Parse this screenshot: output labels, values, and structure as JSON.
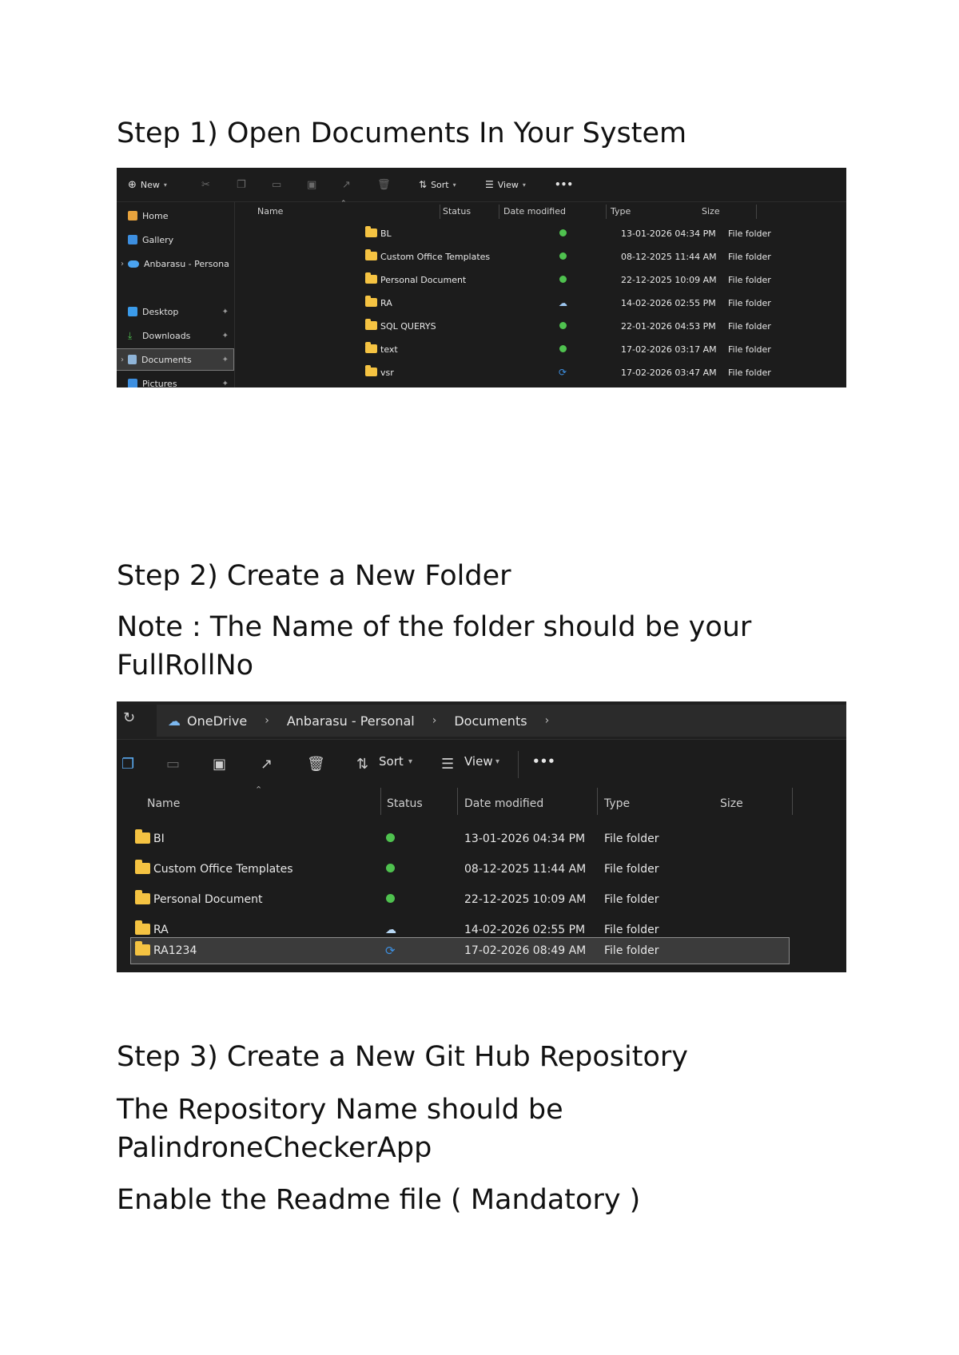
{
  "steps": {
    "step1_title": "Step 1) Open Documents In Your System",
    "step2_title": "Step 2) Create a New Folder",
    "step2_note": "Note : The Name of the folder should be your FullRollNo",
    "step3_title": "Step 3) Create a New Git Hub Repository",
    "step3_line1": "The Repository Name should be PalindroneCheckerApp",
    "step3_line2": "Enable the Readme file ( Mandatory )"
  },
  "shot1": {
    "toolbar": {
      "new": "New",
      "sort": "Sort",
      "view": "View",
      "more": "•••"
    },
    "sidebar": [
      {
        "label": "Home",
        "icon": "home-icon",
        "pinned": false
      },
      {
        "label": "Gallery",
        "icon": "gallery-icon",
        "pinned": false
      },
      {
        "label": "Anbarasu - Persona",
        "icon": "onedrive-icon",
        "pinned": false
      },
      {
        "label": "Desktop",
        "icon": "desktop-icon",
        "pinned": true
      },
      {
        "label": "Downloads",
        "icon": "download-icon",
        "pinned": true
      },
      {
        "label": "Documents",
        "icon": "documents-icon",
        "pinned": true
      },
      {
        "label": "Pictures",
        "icon": "pictures-icon",
        "pinned": true
      }
    ],
    "columns": {
      "name": "Name",
      "status": "Status",
      "date": "Date modified",
      "type": "Type",
      "size": "Size"
    },
    "rows": [
      {
        "name": "BL",
        "status": "synced",
        "date": "13-01-2026 04:34 PM",
        "type": "File folder"
      },
      {
        "name": "Custom Office Templates",
        "status": "synced",
        "date": "08-12-2025 11:44 AM",
        "type": "File folder"
      },
      {
        "name": "Personal Document",
        "status": "synced",
        "date": "22-12-2025 10:09 AM",
        "type": "File folder"
      },
      {
        "name": "RA",
        "status": "cloud",
        "date": "14-02-2026 02:55 PM",
        "type": "File folder"
      },
      {
        "name": "SQL QUERYS",
        "status": "synced",
        "date": "22-01-2026 04:53 PM",
        "type": "File folder"
      },
      {
        "name": "text",
        "status": "synced",
        "date": "17-02-2026 03:17 AM",
        "type": "File folder"
      },
      {
        "name": "vsr",
        "status": "syncing",
        "date": "17-02-2026 03:47 AM",
        "type": "File folder"
      }
    ]
  },
  "shot2": {
    "breadcrumb": [
      "OneDrive",
      "Anbarasu - Personal",
      "Documents"
    ],
    "toolbar": {
      "sort": "Sort",
      "view": "View",
      "more": "•••"
    },
    "columns": {
      "name": "Name",
      "status": "Status",
      "date": "Date modified",
      "type": "Type",
      "size": "Size"
    },
    "rows": [
      {
        "name": "BI",
        "status": "synced",
        "date": "13-01-2026 04:34 PM",
        "type": "File folder"
      },
      {
        "name": "Custom Office Templates",
        "status": "synced",
        "date": "08-12-2025 11:44 AM",
        "type": "File folder"
      },
      {
        "name": "Personal Document",
        "status": "synced",
        "date": "22-12-2025 10:09 AM",
        "type": "File folder"
      },
      {
        "name": "RA",
        "status": "cloud",
        "date": "14-02-2026 02:55 PM",
        "type": "File folder"
      },
      {
        "name": "RA1234",
        "status": "syncing",
        "date": "17-02-2026 08:49 AM",
        "type": "File folder",
        "selected": true
      }
    ]
  }
}
